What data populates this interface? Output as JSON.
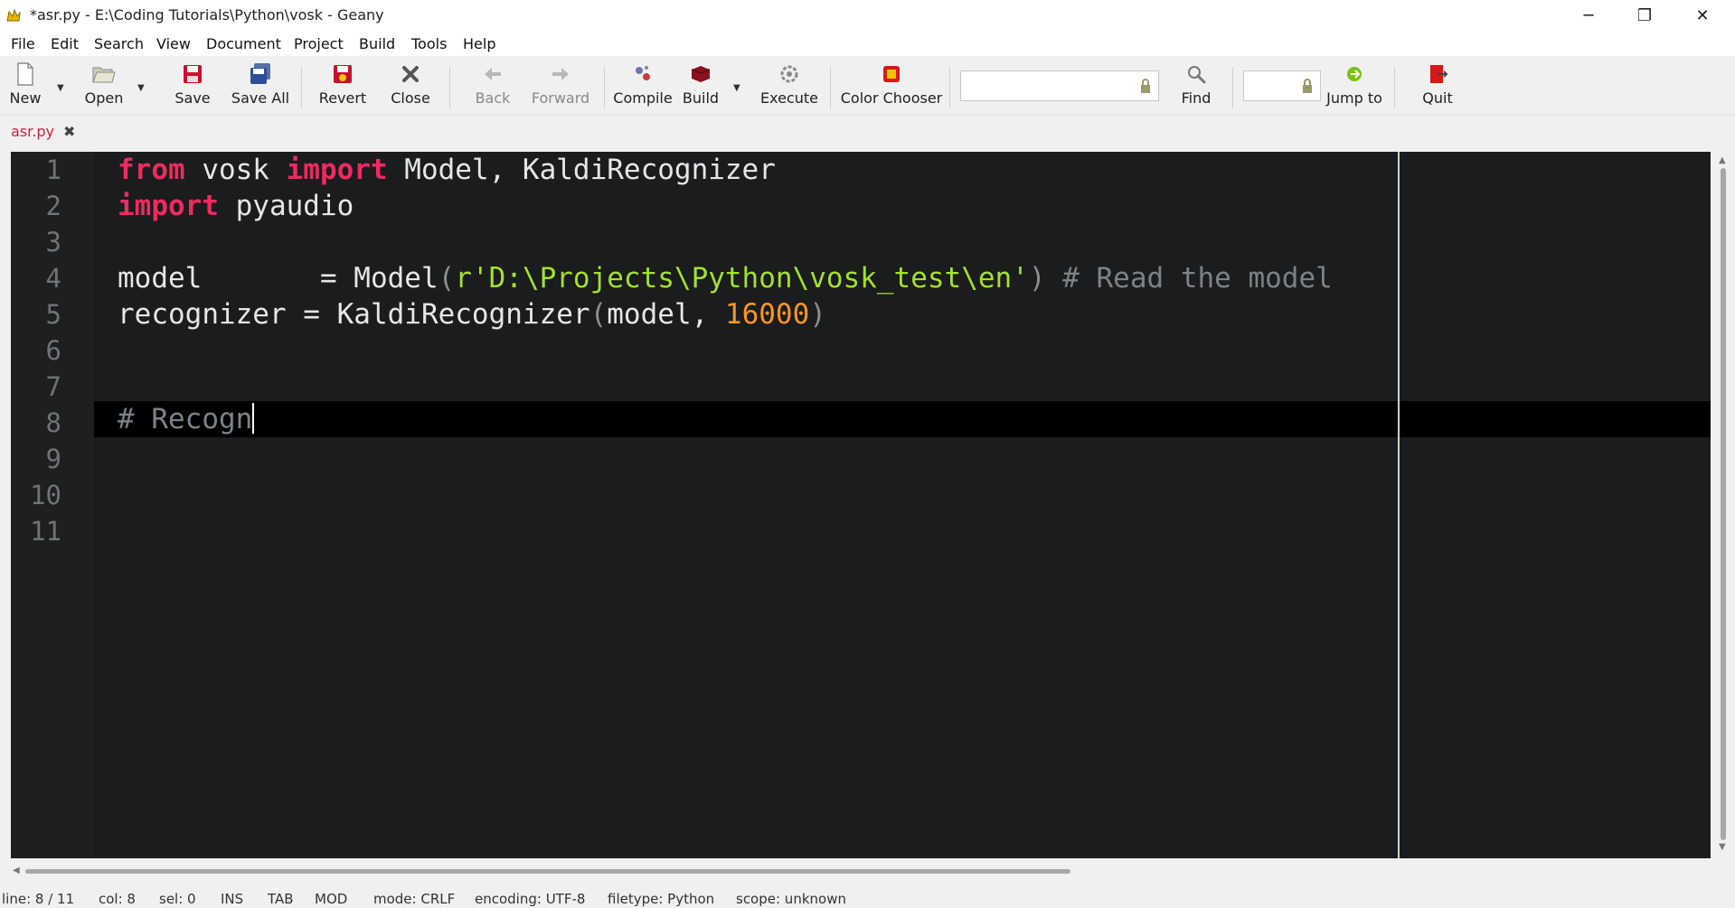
{
  "window": {
    "title": "*asr.py - E:\\Coding Tutorials\\Python\\vosk - Geany",
    "minimize": "─",
    "maximize": "❐",
    "close": "✕"
  },
  "menu": [
    {
      "label": "File"
    },
    {
      "label": "Edit"
    },
    {
      "label": "Search"
    },
    {
      "label": "View"
    },
    {
      "label": "Document"
    },
    {
      "label": "Project"
    },
    {
      "label": "Build"
    },
    {
      "label": "Tools"
    },
    {
      "label": "Help"
    }
  ],
  "toolbar": {
    "new": "New",
    "open": "Open",
    "save": "Save",
    "save_all": "Save All",
    "revert": "Revert",
    "close": "Close",
    "back": "Back",
    "forward": "Forward",
    "compile": "Compile",
    "build": "Build",
    "execute": "Execute",
    "color_chooser": "Color Chooser",
    "search_value": "",
    "find": "Find",
    "goto_value": "",
    "jump_to": "Jump to",
    "quit": "Quit"
  },
  "tab": {
    "label": "asr.py",
    "close": "✖"
  },
  "editor": {
    "line_numbers": [
      "1",
      "2",
      "3",
      "4",
      "5",
      "6",
      "7",
      "8",
      "9",
      "10",
      "11"
    ],
    "line1": {
      "kw1": "from",
      "a": " vosk ",
      "kw2": "import",
      "b": " Model, KaldiRecognizer"
    },
    "line2": {
      "kw": "import",
      "a": " pyaudio"
    },
    "line4": {
      "a": "model       = Model",
      "p1": "(",
      "str": "r'D:\\Projects\\Python\\vosk_test\\en'",
      "p2": ")",
      "cmt": " # Read the model"
    },
    "line5": {
      "a": "recognizer = KaldiRecognizer",
      "p1": "(",
      "b": "model, ",
      "num": "16000",
      "p2": ")"
    },
    "line8": {
      "cmt": "# Recogn"
    }
  },
  "status": {
    "line": "line: 8 / 11",
    "col": "col: 8",
    "sel": "sel: 0",
    "ins": "INS",
    "tab": "TAB",
    "mod": "MOD",
    "mode": "mode: CRLF",
    "encoding": "encoding: UTF-8",
    "filetype": "filetype: Python",
    "scope": "scope: unknown"
  },
  "colors": {
    "keyword": "#ef2a60",
    "string": "#a4e12a",
    "number": "#fd9520",
    "comment": "#7d8286",
    "editor_bg": "#1a1c1d",
    "tab_label": "#d0203a"
  }
}
